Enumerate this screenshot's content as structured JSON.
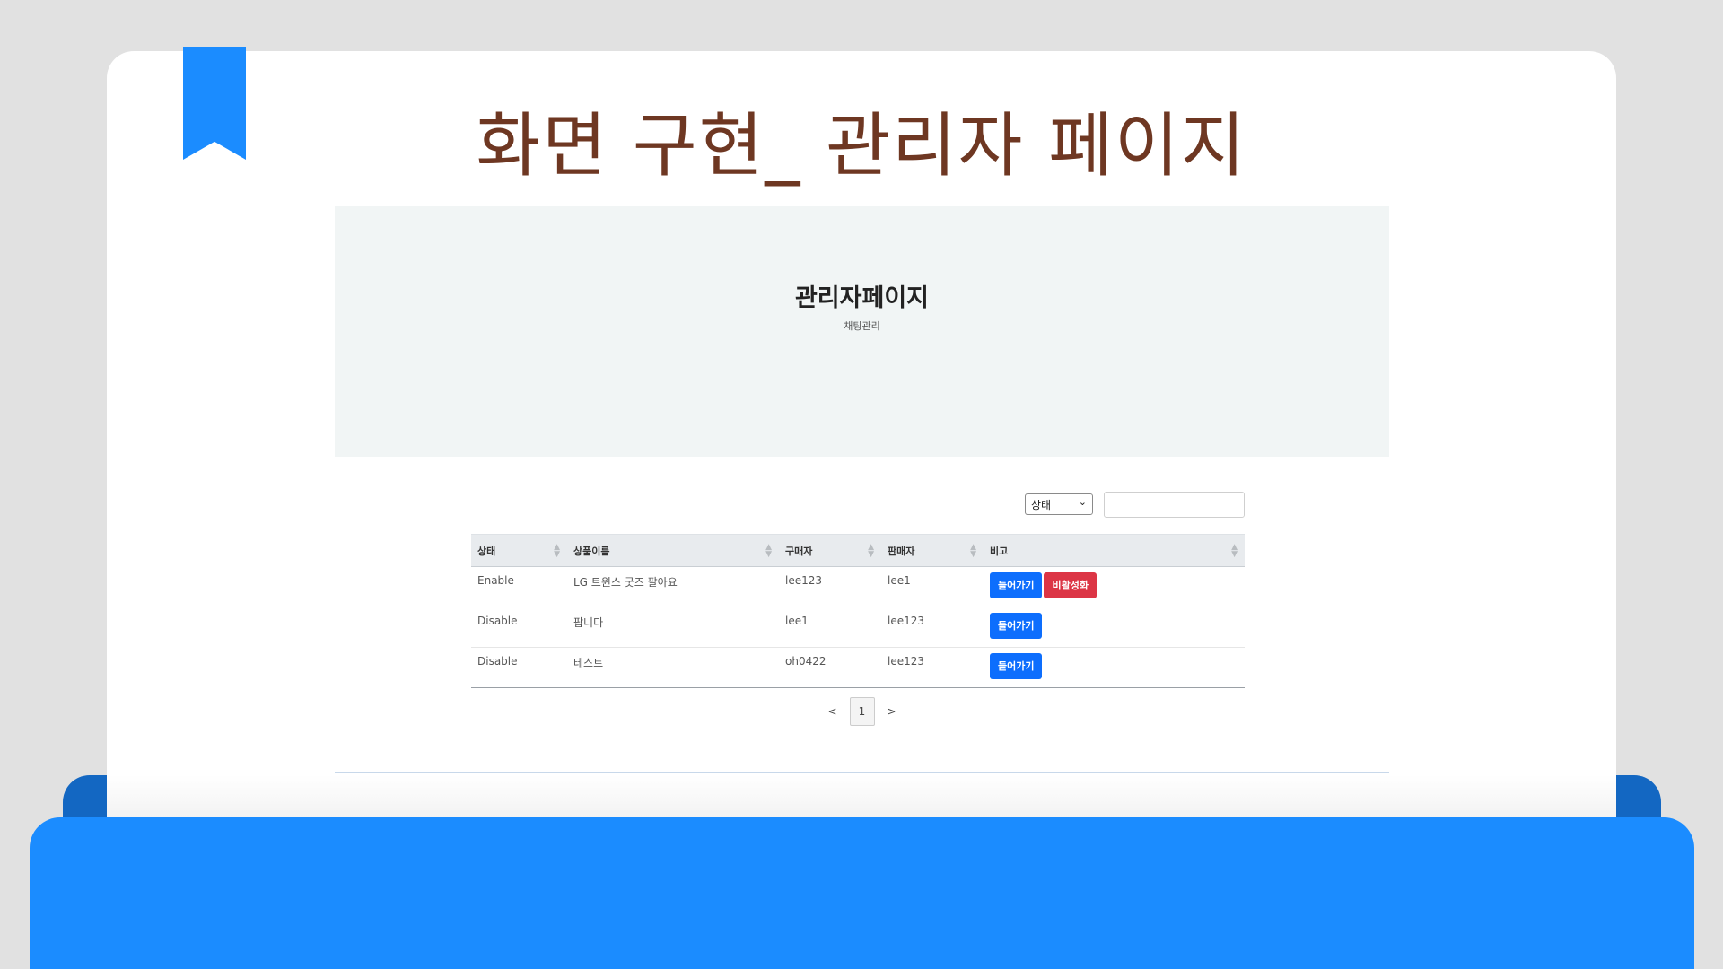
{
  "slide": {
    "title": "화면 구현_ 관리자 페이지"
  },
  "colors": {
    "accent_blue": "#1b8cff",
    "folder_dark_blue": "#1367c2",
    "title_brown": "#6e3722",
    "enable_blue": "#1010e0",
    "disable_red": "#ee1e1e",
    "btn_primary": "#0d6efd",
    "btn_danger": "#dc3545"
  },
  "hero": {
    "title": "관리자페이지",
    "subtitle": "채팅관리"
  },
  "filter": {
    "select_value": "상태",
    "search_value": ""
  },
  "table": {
    "headers": [
      "상태",
      "상품이름",
      "구매자",
      "판매자",
      "비고"
    ],
    "rows": [
      {
        "status": "Enable",
        "product": "LG 트윈스 굿즈 팔아요",
        "buyer": "lee123",
        "seller": "lee1",
        "enter": "들어가기",
        "deactivate": "비활성화"
      },
      {
        "status": "Disable",
        "product": "팝니다",
        "buyer": "lee1",
        "seller": "lee123",
        "enter": "들어가기"
      },
      {
        "status": "Disable",
        "product": "테스트",
        "buyer": "oh0422",
        "seller": "lee123",
        "enter": "들어가기"
      }
    ]
  },
  "pagination": {
    "prev": "<",
    "current": "1",
    "next": ">"
  }
}
